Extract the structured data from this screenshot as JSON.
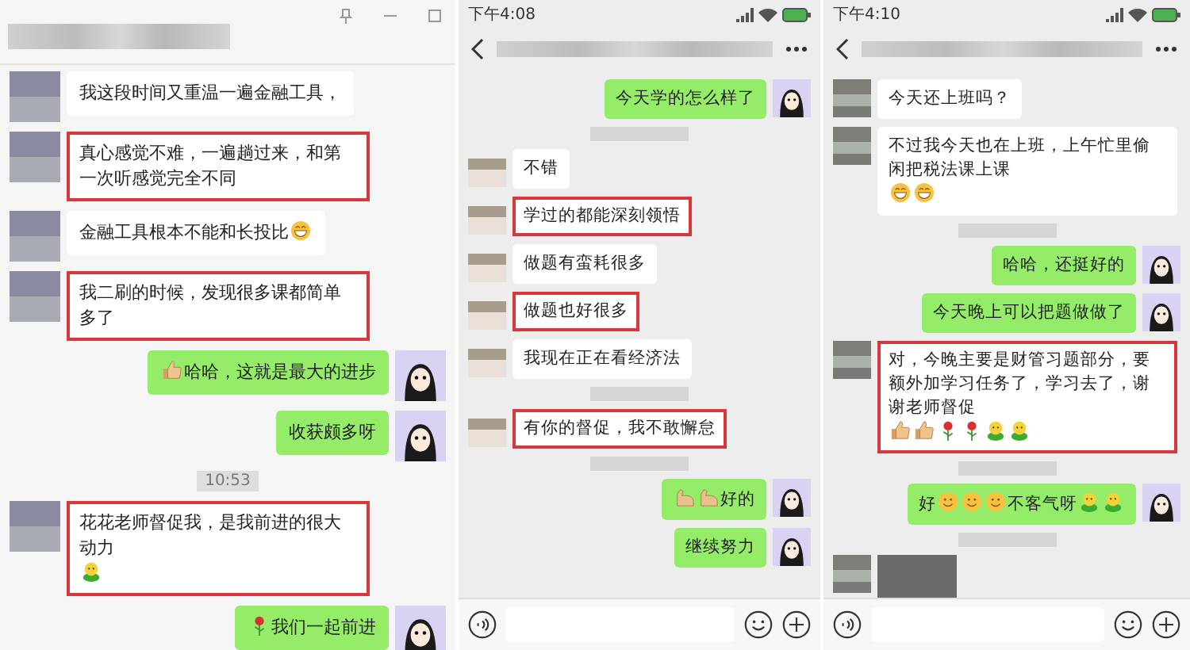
{
  "panels": [
    {
      "kind": "desktop",
      "messages": [
        {
          "kind": "in",
          "highlighted": false,
          "parts": [
            {
              "kind": "text",
              "text": "我这段时间又重温一遍金融工具，"
            }
          ]
        },
        {
          "kind": "in",
          "highlighted": true,
          "parts": [
            {
              "kind": "text",
              "text": "真心感觉不难，一遍趟过来，和第一次听感觉完全不同"
            }
          ]
        },
        {
          "kind": "in",
          "highlighted": false,
          "parts": [
            {
              "kind": "text",
              "text": "金融工具根本不能和长投比"
            },
            {
              "kind": "grin"
            }
          ]
        },
        {
          "kind": "in",
          "highlighted": true,
          "parts": [
            {
              "kind": "text",
              "text": "我二刷的时候，发现很多课都简单多了"
            }
          ]
        },
        {
          "kind": "out",
          "highlighted": false,
          "parts": [
            {
              "kind": "thumbs"
            },
            {
              "kind": "text",
              "text": "哈哈，这就是最大的进步"
            }
          ]
        },
        {
          "kind": "out",
          "highlighted": false,
          "parts": [
            {
              "kind": "text",
              "text": "收获颇多呀"
            }
          ]
        },
        {
          "kind": "time",
          "text": "10:53"
        },
        {
          "kind": "in",
          "highlighted": true,
          "parts": [
            {
              "kind": "text",
              "text": "花花老师督促我，是我前进的很大动力"
            },
            {
              "kind": "sun"
            }
          ]
        },
        {
          "kind": "out",
          "highlighted": false,
          "parts": [
            {
              "kind": "rose"
            },
            {
              "kind": "text",
              "text": "我们一起前进"
            }
          ]
        }
      ]
    },
    {
      "kind": "phone",
      "status_time": "下午4:08",
      "messages": [
        {
          "kind": "out",
          "highlighted": false,
          "parts": [
            {
              "kind": "text",
              "text": "今天学的怎么样了"
            }
          ]
        },
        {
          "kind": "blurred_time"
        },
        {
          "kind": "in",
          "highlighted": false,
          "parts": [
            {
              "kind": "text",
              "text": "不错"
            }
          ]
        },
        {
          "kind": "in",
          "highlighted": true,
          "parts": [
            {
              "kind": "text",
              "text": "学过的都能深刻领悟"
            }
          ]
        },
        {
          "kind": "in",
          "highlighted": false,
          "parts": [
            {
              "kind": "text",
              "text": "做题有蛮耗很多"
            }
          ]
        },
        {
          "kind": "in",
          "highlighted": true,
          "parts": [
            {
              "kind": "text",
              "text": "做题也好很多"
            }
          ]
        },
        {
          "kind": "in",
          "highlighted": false,
          "parts": [
            {
              "kind": "text",
              "text": "我现在正在看经济法"
            }
          ]
        },
        {
          "kind": "blurred_time"
        },
        {
          "kind": "in",
          "highlighted": true,
          "parts": [
            {
              "kind": "text",
              "text": "有你的督促，我不敢懈怠"
            }
          ]
        },
        {
          "kind": "blurred_time"
        },
        {
          "kind": "out",
          "highlighted": false,
          "parts": [
            {
              "kind": "muscle"
            },
            {
              "kind": "muscle"
            },
            {
              "kind": "text",
              "text": "好的"
            }
          ]
        },
        {
          "kind": "out",
          "highlighted": false,
          "parts": [
            {
              "kind": "text",
              "text": "继续努力"
            }
          ]
        }
      ]
    },
    {
      "kind": "phone",
      "status_time": "下午4:10",
      "messages": [
        {
          "kind": "in",
          "highlighted": false,
          "parts": [
            {
              "kind": "text",
              "text": "今天还上班吗？"
            }
          ]
        },
        {
          "kind": "in",
          "highlighted": false,
          "parts": [
            {
              "kind": "text",
              "text": "不过我今天也在上班，上午忙里偷闲把税法课上课"
            },
            {
              "kind": "grin"
            },
            {
              "kind": "grin"
            }
          ]
        },
        {
          "kind": "blurred_time"
        },
        {
          "kind": "out",
          "highlighted": false,
          "parts": [
            {
              "kind": "text",
              "text": "哈哈，还挺好的"
            }
          ]
        },
        {
          "kind": "out",
          "highlighted": false,
          "parts": [
            {
              "kind": "text",
              "text": "今天晚上可以把题做做了"
            }
          ]
        },
        {
          "kind": "in",
          "highlighted": true,
          "parts": [
            {
              "kind": "text",
              "text": "对，今晚主要是财管习题部分，要额外加学习任务了，学习去了，谢谢老师督促"
            },
            {
              "kind": "thumbs"
            },
            {
              "kind": "thumbs"
            },
            {
              "kind": "rose"
            },
            {
              "kind": "rose"
            },
            {
              "kind": "sun"
            },
            {
              "kind": "sun"
            }
          ]
        },
        {
          "kind": "blurred_time"
        },
        {
          "kind": "out",
          "highlighted": false,
          "parts": [
            {
              "kind": "text",
              "text": "好"
            },
            {
              "kind": "smile"
            },
            {
              "kind": "smile"
            },
            {
              "kind": "smile"
            },
            {
              "kind": "text",
              "text": "不客气呀"
            },
            {
              "kind": "sun"
            },
            {
              "kind": "sun"
            }
          ]
        },
        {
          "kind": "blurred_time"
        },
        {
          "kind": "image"
        }
      ]
    }
  ]
}
